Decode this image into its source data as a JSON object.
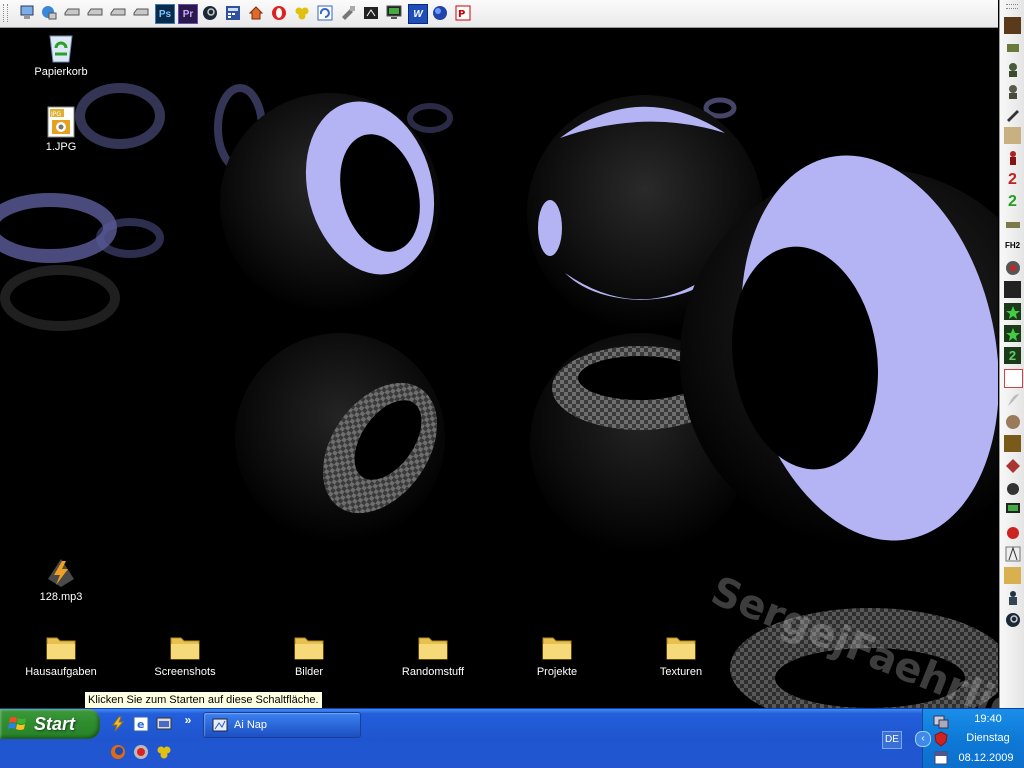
{
  "desktop": {
    "wallpaper_text": "SergejFaehrlich",
    "icons": [
      {
        "label": "Papierkorb",
        "icon": "recycle-bin-icon"
      },
      {
        "label": "1.JPG",
        "icon": "jpg-file-icon"
      },
      {
        "label": "128.mp3",
        "icon": "winamp-mp3-icon"
      },
      {
        "label": "Hausaufgaben",
        "icon": "folder-icon"
      },
      {
        "label": "Screenshots",
        "icon": "folder-icon"
      },
      {
        "label": "Bilder",
        "icon": "folder-icon"
      },
      {
        "label": "Randomstuff",
        "icon": "folder-icon"
      },
      {
        "label": "Projekte",
        "icon": "folder-icon"
      },
      {
        "label": "Texturen",
        "icon": "folder-icon"
      }
    ]
  },
  "top_toolbar": {
    "ps_label": "Ps",
    "pr_label": "Pr",
    "w_label": "W",
    "icons": [
      "computer-icon",
      "network-icon",
      "drive-icon",
      "drive-icon",
      "drive-icon",
      "drive-icon",
      "photoshop-icon",
      "premiere-icon",
      "steam-icon",
      "calculator-icon",
      "home-icon",
      "opera-icon",
      "biohazard-icon",
      "refresh-icon",
      "tool-icon",
      "media-icon",
      "screen-icon",
      "word-icon",
      "orb-icon",
      "pdf-icon"
    ]
  },
  "right_toolbar": {
    "labels": {
      "two_red": "2",
      "two_green": "2",
      "fh2": "FH2",
      "two_box": "2"
    }
  },
  "tooltip": {
    "text": "Klicken Sie zum Starten auf diese Schaltfläche."
  },
  "taskbar": {
    "start_label": "Start",
    "quicklaunch_more": "»",
    "active_task": "Ai Nap",
    "language": "DE",
    "clock": {
      "time": "19:40",
      "day": "Dienstag",
      "date": "08.12.2009"
    },
    "colors": {
      "taskbar": "#245edb",
      "start": "#2f8c2f",
      "tray": "#0e79d8"
    }
  }
}
